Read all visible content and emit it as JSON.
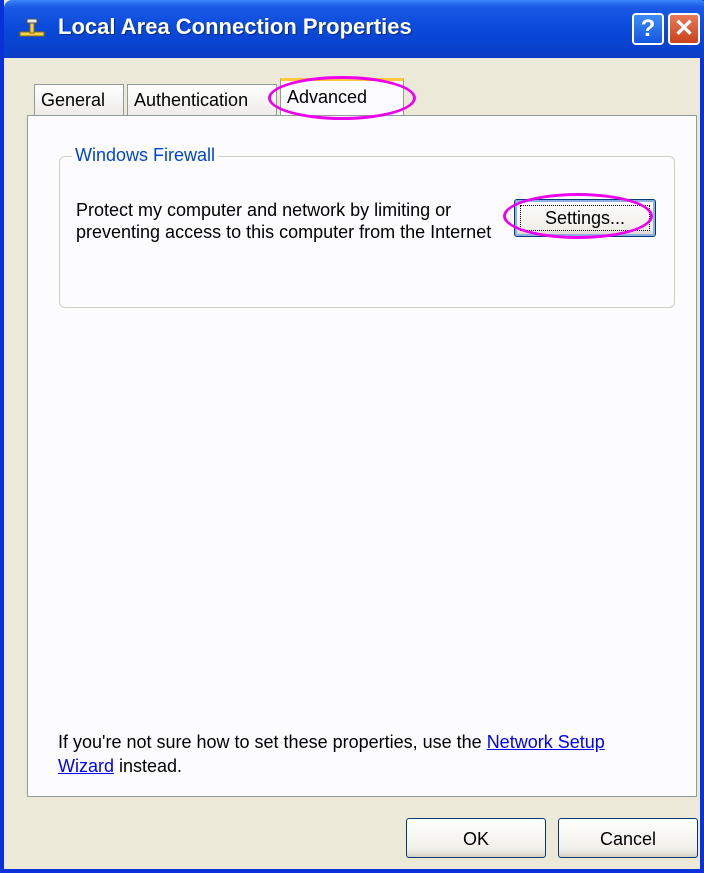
{
  "window": {
    "title": "Local Area Connection Properties",
    "help_button": "?",
    "close_button": "✕"
  },
  "tabs": [
    {
      "label": "General"
    },
    {
      "label": "Authentication"
    },
    {
      "label": "Advanced",
      "selected": true
    }
  ],
  "firewall_group": {
    "legend": "Windows Firewall",
    "description": "Protect my computer and network by limiting or preventing access to this computer from the Internet",
    "settings_button": "Settings..."
  },
  "info": {
    "prefix": "If you're not sure how to set these properties, use the ",
    "link": "Network Setup Wizard",
    "suffix": " instead."
  },
  "buttons": {
    "ok": "OK",
    "cancel": "Cancel"
  },
  "colors": {
    "titlebar": "#0B4BDB",
    "dialog_bg": "#ECE9D8",
    "group_legend": "#0046D5",
    "annotation": "#EE00EE",
    "link": "#0000FF"
  }
}
